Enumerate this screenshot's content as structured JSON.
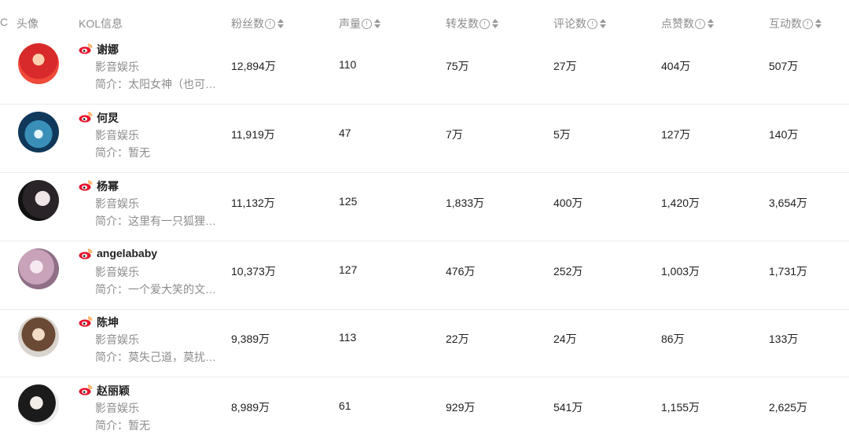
{
  "table": {
    "edge_char": "C",
    "headers": {
      "avatar": "头像",
      "kol_info": "KOL信息",
      "fans": "粉丝数",
      "voice": "声量",
      "forwards": "转发数",
      "comments": "评论数",
      "likes": "点赞数",
      "interactions": "互动数"
    },
    "info_glyph": "!",
    "rows": [
      {
        "name": "谢娜",
        "category": "影音娱乐",
        "bio": "简介：太阳女神（也可…",
        "fans": "12,894万",
        "voice": "110",
        "forwards": "75万",
        "comments": "27万",
        "likes": "404万",
        "interactions": "507万"
      },
      {
        "name": "何炅",
        "category": "影音娱乐",
        "bio": "简介：暂无",
        "fans": "11,919万",
        "voice": "47",
        "forwards": "7万",
        "comments": "5万",
        "likes": "127万",
        "interactions": "140万"
      },
      {
        "name": "杨幂",
        "category": "影音娱乐",
        "bio": "简介：这里有一只狐狸…",
        "fans": "11,132万",
        "voice": "125",
        "forwards": "1,833万",
        "comments": "400万",
        "likes": "1,420万",
        "interactions": "3,654万"
      },
      {
        "name": "angelababy",
        "category": "影音娱乐",
        "bio": "简介：一个爱大笑的文…",
        "fans": "10,373万",
        "voice": "127",
        "forwards": "476万",
        "comments": "252万",
        "likes": "1,003万",
        "interactions": "1,731万"
      },
      {
        "name": "陈坤",
        "category": "影音娱乐",
        "bio": "简介：莫失己道，莫扰…",
        "fans": "9,389万",
        "voice": "113",
        "forwards": "22万",
        "comments": "24万",
        "likes": "86万",
        "interactions": "133万"
      },
      {
        "name": "赵丽颖",
        "category": "影音娱乐",
        "bio": "简介：暂无",
        "fans": "8,989万",
        "voice": "61",
        "forwards": "929万",
        "comments": "541万",
        "likes": "1,155万",
        "interactions": "2,625万"
      }
    ]
  },
  "icons": {
    "platform": "weibo-icon",
    "info": "info-circle-icon",
    "sort": "sort-up-down-icon"
  },
  "colors": {
    "weibo_red": "#e6162d",
    "weibo_yellow": "#ff9933",
    "header_text": "#8c8c8c",
    "divider": "#ececec",
    "primary_text": "#1f1f1f"
  }
}
